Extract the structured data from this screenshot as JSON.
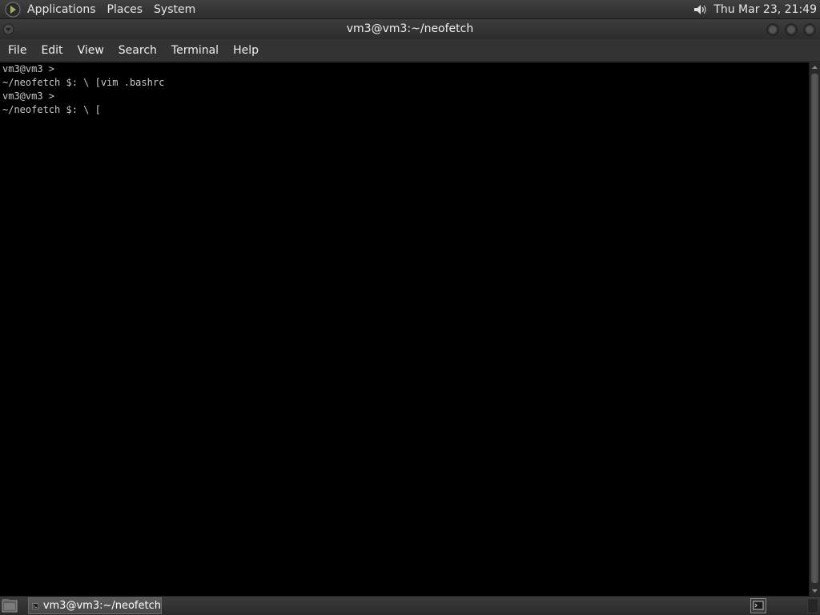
{
  "top_panel": {
    "menus": [
      "Applications",
      "Places",
      "System"
    ],
    "clock": "Thu Mar 23, 21:49",
    "logo_icon": "gnome-foot-icon",
    "volume_icon": "speaker-icon"
  },
  "window": {
    "title": "vm3@vm3:~/neofetch",
    "menubar": [
      "File",
      "Edit",
      "View",
      "Search",
      "Terminal",
      "Help"
    ]
  },
  "terminal": {
    "lines": [
      "vm3@vm3 >",
      "~/neofetch $: \\ [vim .bashrc",
      "vm3@vm3 >",
      "~/neofetch $: \\ ["
    ],
    "background": "#000000",
    "foreground": "#c8c8c8"
  },
  "bottom_panel": {
    "taskbar_items": [
      {
        "label": "vm3@vm3:~/neofetch",
        "icon": "terminal-icon"
      }
    ]
  }
}
